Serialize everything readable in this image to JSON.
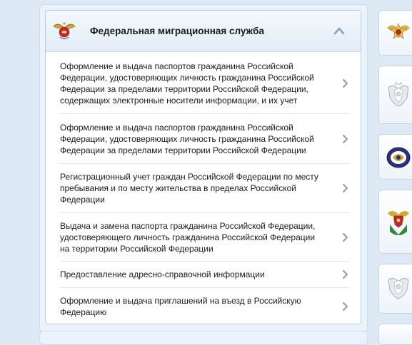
{
  "panel": {
    "title": "Федеральная миграционная служба",
    "emblem_icon": "fms-emblem-icon",
    "collapse_icon": "chevron-up-icon"
  },
  "services": [
    {
      "label": "Оформление и выдача паспортов гражданина Российской Федерации, удостоверяющих личность гражданина Российской Федерации за пределами территории Российской Федерации, содержащих электронные носители информации, и их учет"
    },
    {
      "label": "Оформление и выдача паспортов гражданина Российской Федерации, удостоверяющих личность гражданина Российской Федерации за пределами территории Российской Федерации"
    },
    {
      "label": "Регистрационный учет граждан Российской Федерации по месту пребывания и по месту жительства в пределах Российской Федерации"
    },
    {
      "label": "Выдача и замена паспорта гражданина Российской Федерации, удостоверяющего личность гражданина Российской Федерации на территории Российской Федерации"
    },
    {
      "label": "Предоставление адресно-справочной информации"
    },
    {
      "label": "Оформление и выдача приглашений на въезд в Российскую Федерацию"
    }
  ],
  "side_icons": [
    "mvd-emblem-icon",
    "russian-emblem-icon",
    "agency-seal-icon",
    "agency-emblem-icon",
    "russian-emblem-icon"
  ],
  "colors": {
    "accent": "#1a4fa0",
    "border": "#b9cde4",
    "background": "#dde9f5"
  }
}
